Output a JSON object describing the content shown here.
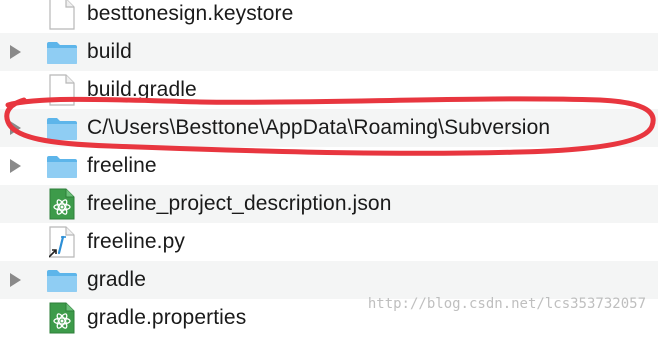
{
  "files": [
    {
      "name": "besttonesign.keystore",
      "kind": "document",
      "icon": "document-icon",
      "expandable": false
    },
    {
      "name": "build",
      "kind": "folder",
      "icon": "folder-icon",
      "expandable": true
    },
    {
      "name": "build.gradle",
      "kind": "document",
      "icon": "document-icon",
      "expandable": false
    },
    {
      "name": "C/\\Users\\Besttone\\AppData\\Roaming\\Subversion",
      "kind": "folder",
      "icon": "folder-icon",
      "expandable": true
    },
    {
      "name": "freeline",
      "kind": "folder",
      "icon": "folder-icon",
      "expandable": true
    },
    {
      "name": "freeline_project_description.json",
      "kind": "json",
      "icon": "atom-json-icon",
      "expandable": false
    },
    {
      "name": "freeline.py",
      "kind": "python",
      "icon": "python-script-icon",
      "expandable": false
    },
    {
      "name": "gradle",
      "kind": "folder",
      "icon": "folder-icon",
      "expandable": true
    },
    {
      "name": "gradle.properties",
      "kind": "json",
      "icon": "atom-properties-icon",
      "expandable": false
    }
  ],
  "annotation_color": "#e8363f",
  "watermark": "http://blog.csdn.net/lcs353732057"
}
